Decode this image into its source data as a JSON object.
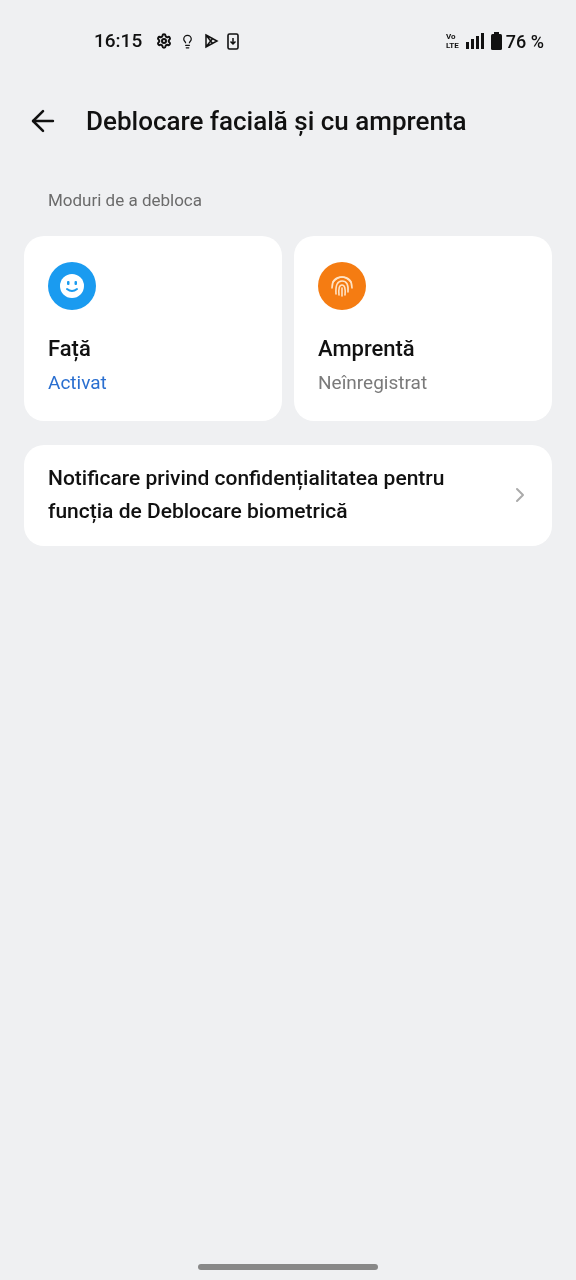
{
  "status_bar": {
    "time": "16:15",
    "network": [
      "Vo",
      "LTE"
    ],
    "battery": "76 %"
  },
  "header": {
    "title": "Deblocare facială și cu amprenta"
  },
  "section_title": "Moduri de a debloca",
  "methods": [
    {
      "kind": "face",
      "title": "Față",
      "status": "Activat",
      "enabled": true
    },
    {
      "kind": "fingerprint",
      "title": "Amprentă",
      "status": "Neînregistrat",
      "enabled": false
    }
  ],
  "privacy_item": {
    "label": "Notificare privind confidențialitatea pentru funcția de Deblocare biometrică"
  }
}
